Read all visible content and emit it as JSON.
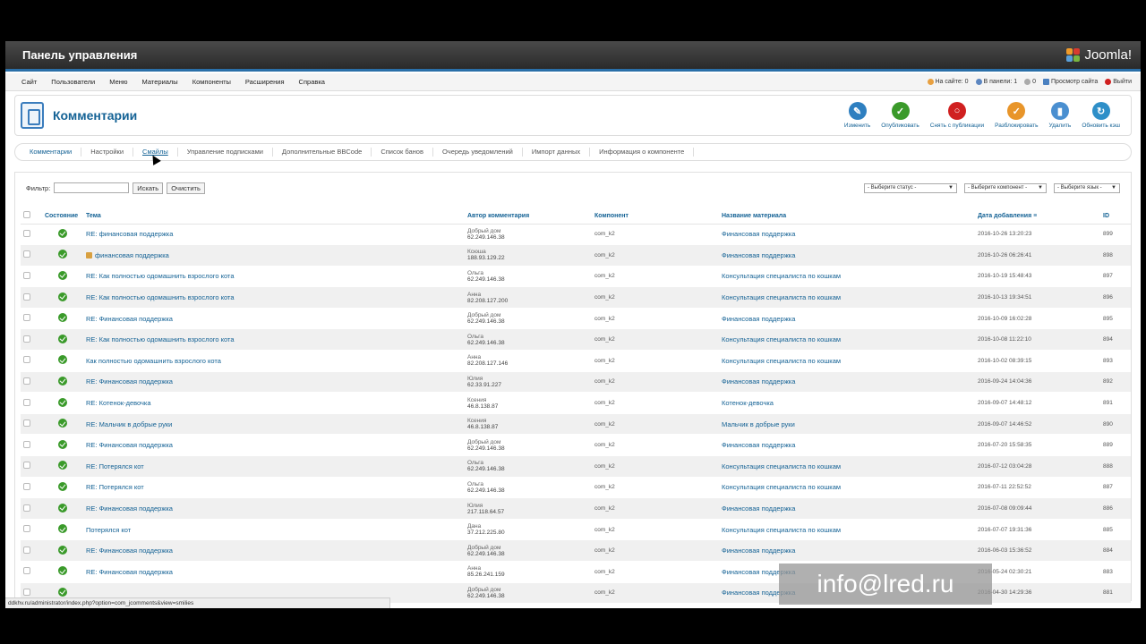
{
  "header": {
    "title": "Панель управления",
    "logo_text": "Joomla!"
  },
  "menu": [
    "Сайт",
    "Пользователи",
    "Меню",
    "Материалы",
    "Компоненты",
    "Расширения",
    "Справка"
  ],
  "status": {
    "on_site": "На сайте: 0",
    "in_panel": "В панели: 1",
    "messages": "0",
    "preview": "Просмотр сайта",
    "logout": "Выйти"
  },
  "page_title": "Комментарии",
  "toolbar": [
    {
      "label": "Изменить",
      "color": "#2e7fc0",
      "icon": "edit-icon",
      "glyph": "✎"
    },
    {
      "label": "Опубликовать",
      "color": "#3a9a2a",
      "icon": "publish-icon",
      "glyph": "✓"
    },
    {
      "label": "Снять с публикации",
      "color": "#d02020",
      "icon": "unpublish-icon",
      "glyph": "○"
    },
    {
      "label": "Разблокировать",
      "color": "#e8952a",
      "icon": "checkin-icon",
      "glyph": "✓"
    },
    {
      "label": "Удалить",
      "color": "#4a8fd0",
      "icon": "trash-icon",
      "glyph": "▮"
    },
    {
      "label": "Обновить кэш",
      "color": "#2e8fc8",
      "icon": "refresh-icon",
      "glyph": "↻"
    }
  ],
  "tabs": [
    "Комментарии",
    "Настройки",
    "Смайлы",
    "Управление подписками",
    "Дополнительные BBCode",
    "Список банов",
    "Очередь уведомлений",
    "Импорт данных",
    "Информация о компоненте"
  ],
  "filter": {
    "label": "Фильтр:",
    "search_button": "Искать",
    "reset_button": "Очистить",
    "status_select": "- Выберите статус -",
    "component_select": "- Выберите компонент -",
    "language_select": "- Выберите язык -"
  },
  "columns": {
    "state": "Состояние",
    "topic": "Тема",
    "author": "Автор комментария",
    "component": "Компонент",
    "material": "Название материала",
    "date": "Дата добавления",
    "id": "ID"
  },
  "rows": [
    {
      "topic": "RE: финансовая поддержка",
      "name": "Добрый дом",
      "ip": "62.249.146.38",
      "component": "com_k2",
      "material": "Финансовая поддержка",
      "date": "2016-10-26 13:20:23",
      "id": "899",
      "locked": false
    },
    {
      "topic": "финансовая поддержка",
      "name": "Ксюша",
      "ip": "188.93.129.22",
      "component": "com_k2",
      "material": "Финансовая поддержка",
      "date": "2016-10-26 06:26:41",
      "id": "898",
      "locked": true
    },
    {
      "topic": "RE: Как полностью одомашнить взрослого кота",
      "name": "Ольга",
      "ip": "62.249.146.38",
      "component": "com_k2",
      "material": "Консультация специалиста по кошкам",
      "date": "2016-10-19 15:48:43",
      "id": "897",
      "locked": false
    },
    {
      "topic": "RE: Как полностью одомашнить взрослого кота",
      "name": "Анна",
      "ip": "82.208.127.200",
      "component": "com_k2",
      "material": "Консультация специалиста по кошкам",
      "date": "2016-10-13 19:34:51",
      "id": "896",
      "locked": false
    },
    {
      "topic": "RE: Финансовая поддержка",
      "name": "Добрый дом",
      "ip": "62.249.146.38",
      "component": "com_k2",
      "material": "Финансовая поддержка",
      "date": "2016-10-09 16:02:28",
      "id": "895",
      "locked": false
    },
    {
      "topic": "RE: Как полностью одомашнить взрослого кота",
      "name": "Ольга",
      "ip": "62.249.146.38",
      "component": "com_k2",
      "material": "Консультация специалиста по кошкам",
      "date": "2016-10-08 11:22:10",
      "id": "894",
      "locked": false
    },
    {
      "topic": "Как полностью одомашнить взрослого кота",
      "name": "Анна",
      "ip": "82.208.127.146",
      "component": "com_k2",
      "material": "Консультация специалиста по кошкам",
      "date": "2016-10-02 08:39:15",
      "id": "893",
      "locked": false
    },
    {
      "topic": "RE: Финансовая поддержка",
      "name": "Юлия",
      "ip": "62.33.91.227",
      "component": "com_k2",
      "material": "Финансовая поддержка",
      "date": "2016-09-24 14:04:36",
      "id": "892",
      "locked": false
    },
    {
      "topic": "RE: Котенок-девочка",
      "name": "Ксения",
      "ip": "46.8.138.87",
      "component": "com_k2",
      "material": "Котенок-девочка",
      "date": "2016-09-07 14:48:12",
      "id": "891",
      "locked": false
    },
    {
      "topic": "RE: Мальчик в добрые руки",
      "name": "Ксения",
      "ip": "46.8.138.87",
      "component": "com_k2",
      "material": "Мальчик в добрые руки",
      "date": "2016-09-07 14:46:52",
      "id": "890",
      "locked": false
    },
    {
      "topic": "RE: Финансовая поддержка",
      "name": "Добрый дом",
      "ip": "62.249.146.38",
      "component": "com_k2",
      "material": "Финансовая поддержка",
      "date": "2016-07-20 15:58:35",
      "id": "889",
      "locked": false
    },
    {
      "topic": "RE: Потерялся кот",
      "name": "Ольга",
      "ip": "62.249.146.38",
      "component": "com_k2",
      "material": "Консультация специалиста по кошкам",
      "date": "2016-07-12 03:04:28",
      "id": "888",
      "locked": false
    },
    {
      "topic": "RE: Потерялся кот",
      "name": "Ольга",
      "ip": "62.249.146.38",
      "component": "com_k2",
      "material": "Консультация специалиста по кошкам",
      "date": "2016-07-11 22:52:52",
      "id": "887",
      "locked": false
    },
    {
      "topic": "RE: Финансовая поддержка",
      "name": "Юлия",
      "ip": "217.118.64.57",
      "component": "com_k2",
      "material": "Финансовая поддержка",
      "date": "2016-07-08 09:09:44",
      "id": "886",
      "locked": false
    },
    {
      "topic": "Потерялся кот",
      "name": "Дана",
      "ip": "37.212.225.80",
      "component": "com_k2",
      "material": "Консультация специалиста по кошкам",
      "date": "2016-07-07 19:31:36",
      "id": "885",
      "locked": false
    },
    {
      "topic": "RE: Финансовая поддержка",
      "name": "Добрый дом",
      "ip": "62.249.146.38",
      "component": "com_k2",
      "material": "Финансовая поддержка",
      "date": "2016-06-03 15:36:52",
      "id": "884",
      "locked": false
    },
    {
      "topic": "RE: Финансовая поддержка",
      "name": "Анна",
      "ip": "85.26.241.159",
      "component": "com_k2",
      "material": "Финансовая поддержка",
      "date": "2016-05-24 02:30:21",
      "id": "883",
      "locked": false
    },
    {
      "topic": "",
      "name": "Добрый дом",
      "ip": "62.249.146.38",
      "component": "com_k2",
      "material": "Финансовая поддержка",
      "date": "2016-04-30 14:29:36",
      "id": "881",
      "locked": false
    }
  ],
  "status_url": "ddkhv.ru/administrator/index.php?option=com_jcomments&view=smilies",
  "watermark": "info@lred.ru"
}
